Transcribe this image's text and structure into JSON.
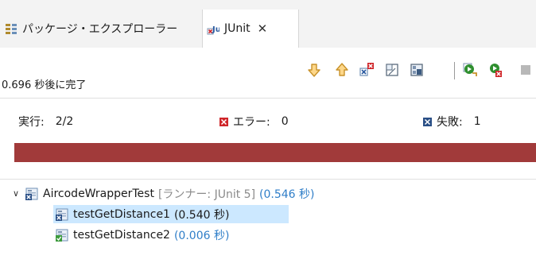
{
  "tabs": {
    "package_explorer": "パッケージ・エクスプローラー",
    "junit": "JUnit",
    "close": "✕"
  },
  "status": "0.696 秒後に完了",
  "counters": {
    "runs_label": "実行:",
    "runs_value": "2/2",
    "errors_label": "エラー:",
    "errors_value": "0",
    "failures_label": "失敗:",
    "failures_value": "1"
  },
  "progress": {
    "state": "failed",
    "fraction": 1.0,
    "color": "#a13a3a"
  },
  "tree": {
    "suite": {
      "name": "AircodeWrapperTest",
      "runner": "[ランナー: JUnit 5]",
      "time": "(0.546 秒)"
    },
    "tests": [
      {
        "name": "testGetDistance1",
        "time": "(0.540 秒)",
        "status": "failed",
        "selected": true
      },
      {
        "name": "testGetDistance2",
        "time": "(0.006 秒)",
        "status": "passed",
        "selected": false
      }
    ]
  },
  "toolbar_icons": [
    "next-failure-icon",
    "previous-failure-icon",
    "show-failures-only-icon",
    "scroll-lock-icon",
    "show-skipped-only-icon",
    "rerun-test-icon",
    "rerun-failed-first-icon",
    "stop-icon"
  ],
  "colors": {
    "failure_bar": "#a13a3a",
    "selection": "#cce8ff",
    "info_text": "#2f7ec8",
    "runner_text": "#8a8a8a"
  }
}
